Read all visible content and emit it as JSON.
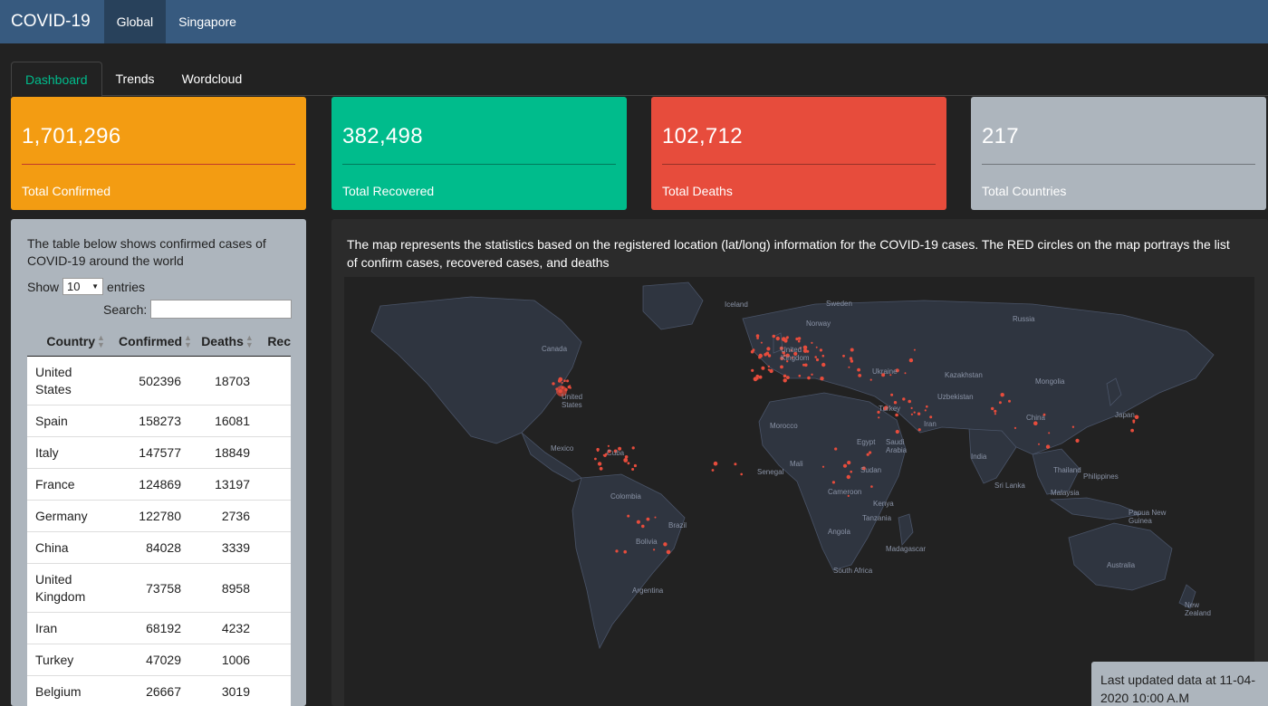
{
  "navbar": {
    "brand": "COVID-19",
    "links": [
      "Global",
      "Singapore"
    ]
  },
  "tabs": [
    "Dashboard",
    "Trends",
    "Wordcloud"
  ],
  "colors": {
    "navbar": "#375a7f",
    "confirmed": "#f39c12",
    "recovered": "#00bc8c",
    "deaths": "#e74c3c",
    "countries": "#adb5bd",
    "accent": "#00bc8c",
    "case_marker": "#e74c3c"
  },
  "value_boxes": [
    {
      "value": "1,701,296",
      "label": "Total Confirmed"
    },
    {
      "value": "382,498",
      "label": "Total Recovered"
    },
    {
      "value": "102,712",
      "label": "Total Deaths"
    },
    {
      "value": "217",
      "label": "Total Countries"
    }
  ],
  "table_panel": {
    "description": "The table below shows confirmed cases of COVID-19 around the world",
    "show_label": "Show",
    "entries_value": "10",
    "entries_label": "entries",
    "search_label": "Search:",
    "search_value": "",
    "columns": [
      "Country",
      "Confirmed",
      "Deaths",
      "Rec"
    ],
    "rows": [
      {
        "country": "United States",
        "confirmed": "502396",
        "deaths": "18703"
      },
      {
        "country": "Spain",
        "confirmed": "158273",
        "deaths": "16081"
      },
      {
        "country": "Italy",
        "confirmed": "147577",
        "deaths": "18849"
      },
      {
        "country": "France",
        "confirmed": "124869",
        "deaths": "13197"
      },
      {
        "country": "Germany",
        "confirmed": "122780",
        "deaths": "2736"
      },
      {
        "country": "China",
        "confirmed": "84028",
        "deaths": "3339"
      },
      {
        "country": "United Kingdom",
        "confirmed": "73758",
        "deaths": "8958"
      },
      {
        "country": "Iran",
        "confirmed": "68192",
        "deaths": "4232"
      },
      {
        "country": "Turkey",
        "confirmed": "47029",
        "deaths": "1006"
      },
      {
        "country": "Belgium",
        "confirmed": "26667",
        "deaths": "3019"
      }
    ]
  },
  "map_panel": {
    "description": "The map represents the statistics based on the registered location (lat/long) information for the COVID-19 cases. The RED circles on the map portrays the list of confirm cases, recovered cases, and deaths",
    "labels": [
      "Iceland",
      "Sweden",
      "Norway",
      "Russia",
      "Canada",
      "United Kingdom",
      "Ukraine",
      "Kazakhstan",
      "Mongolia",
      "Uzbekistan",
      "United States",
      "Turkey",
      "China",
      "Japan",
      "Iran",
      "Morocco",
      "Egypt",
      "Saudi Arabia",
      "Mexico",
      "Cuba",
      "India",
      "Thailand",
      "Philippines",
      "Mali",
      "Senegal",
      "Sudan",
      "Sri Lanka",
      "Malaysia",
      "Colombia",
      "Cameroon",
      "Kenya",
      "Papua New Guinea",
      "Tanzania",
      "Brazil",
      "Angola",
      "Bolivia",
      "Madagascar",
      "Australia",
      "South Africa",
      "Argentina",
      "New Zealand"
    ]
  },
  "updated": "Last updated data at 11-04-2020 10:00 A.M"
}
